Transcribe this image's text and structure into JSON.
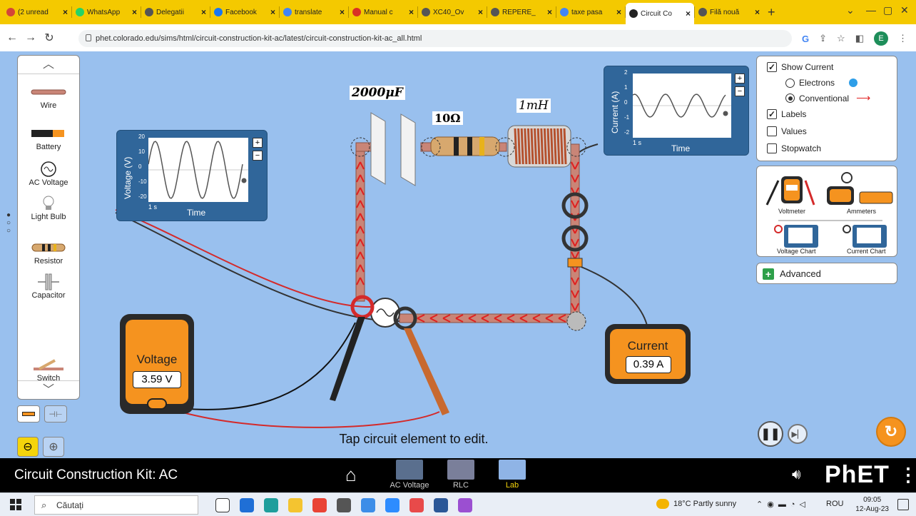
{
  "browser": {
    "tabs": [
      {
        "label": "(2 unread",
        "icon_color": "#d44638",
        "icon": "mail-icon"
      },
      {
        "label": "WhatsApp",
        "icon_color": "#25d366",
        "icon": "whatsapp-icon"
      },
      {
        "label": "Delegatii",
        "icon_color": "#555555",
        "icon": "globe-icon"
      },
      {
        "label": "Facebook",
        "icon_color": "#1877f2",
        "icon": "facebook-icon"
      },
      {
        "label": "translate",
        "icon_color": "#4285f4",
        "icon": "google-icon"
      },
      {
        "label": "Manual c",
        "icon_color": "#d93025",
        "icon": "pdf-icon"
      },
      {
        "label": "XC40_Ov",
        "icon_color": "#555555",
        "icon": "globe-icon"
      },
      {
        "label": "REPERE_",
        "icon_color": "#555555",
        "icon": "globe-icon"
      },
      {
        "label": "taxe pasa",
        "icon_color": "#4285f4",
        "icon": "google-icon"
      },
      {
        "label": "Circuit Co",
        "icon_color": "#222222",
        "icon": "phet-icon"
      },
      {
        "label": "Filă nouă",
        "icon_color": "#555555",
        "icon": "globe-icon"
      }
    ],
    "active_tab_index": 9,
    "url": "phet.colorado.edu/sims/html/circuit-construction-kit-ac/latest/circuit-construction-kit-ac_all.html",
    "profile_initial": "E"
  },
  "toolbox": {
    "items": [
      {
        "label": "Wire",
        "icon": "wire-icon"
      },
      {
        "label": "Battery",
        "icon": "battery-icon"
      },
      {
        "label": "AC Voltage",
        "icon": "ac-voltage-icon"
      },
      {
        "label": "Light Bulb",
        "icon": "light-bulb-icon"
      },
      {
        "label": "Resistor",
        "icon": "resistor-icon"
      },
      {
        "label": "Capacitor",
        "icon": "capacitor-icon"
      },
      {
        "label": "Switch",
        "icon": "switch-icon"
      }
    ]
  },
  "voltage_chart": {
    "ylabel": "Voltage (V)",
    "ticks": [
      "20",
      "10",
      "0",
      "-10",
      "-20"
    ],
    "scale": "1 s",
    "xlabel": "Time"
  },
  "current_chart": {
    "ylabel": "Current (A)",
    "ticks": [
      "2",
      "1",
      "0",
      "-1",
      "-2"
    ],
    "scale": "1 s",
    "xlabel": "Time"
  },
  "circuit": {
    "capacitor_label": "2000μF",
    "resistor_label": "10Ω",
    "inductor_label": "1mH"
  },
  "options_panel": {
    "show_current": {
      "label": "Show Current",
      "checked": true
    },
    "electrons": {
      "label": "Electrons",
      "selected": false
    },
    "conventional": {
      "label": "Conventional",
      "selected": true
    },
    "labels": {
      "label": "Labels",
      "checked": true
    },
    "values": {
      "label": "Values",
      "checked": false
    },
    "stopwatch": {
      "label": "Stopwatch",
      "checked": false
    }
  },
  "sensors_panel": {
    "voltmeter": "Voltmeter",
    "ammeters": "Ammeters",
    "voltage_chart": "Voltage Chart",
    "current_chart": "Current Chart"
  },
  "advanced": {
    "label": "Advanced"
  },
  "voltmeter": {
    "title": "Voltage",
    "value": "3.59 V"
  },
  "ammeter": {
    "title": "Current",
    "value": "0.39 A"
  },
  "hint": "Tap circuit element to edit.",
  "navbar": {
    "title": "Circuit Construction Kit: AC",
    "screens": [
      {
        "label": "AC Voltage",
        "active": false
      },
      {
        "label": "RLC",
        "active": false
      },
      {
        "label": "Lab",
        "active": true
      }
    ],
    "logo": "PhET"
  },
  "taskbar": {
    "search_placeholder": "Căutați",
    "weather": "18°C Partly sunny",
    "language": "ROU",
    "time": "09:05",
    "date": "12-Aug-23"
  },
  "colors": {
    "sim_background": "#99c0ee",
    "accent_yellow": "#f4d40b",
    "chart_frame": "#30669a",
    "meter_orange": "#f5931f",
    "current_arrow": "#e02020"
  }
}
